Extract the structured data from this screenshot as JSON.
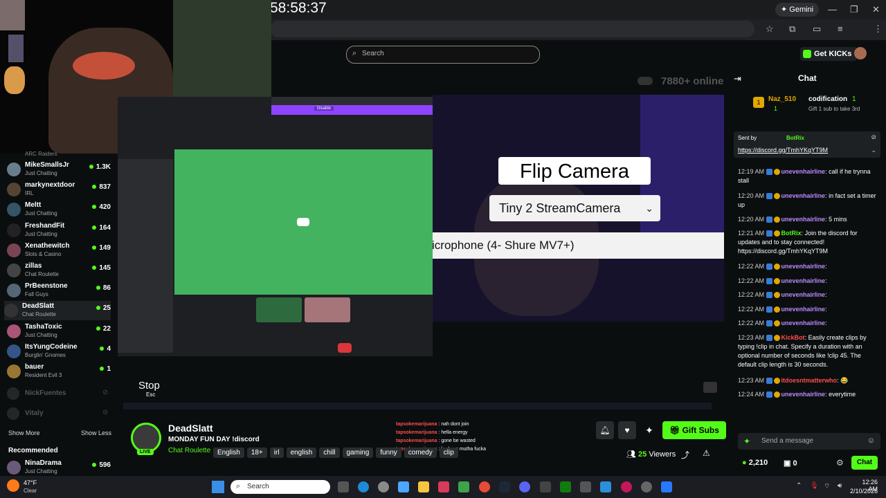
{
  "overlay_timer": "58:58:37",
  "browser": {
    "gemini_label": "Gemini",
    "controls": [
      "—",
      "❐",
      "✕"
    ]
  },
  "kick": {
    "search_placeholder": "Search",
    "get_kicks": "Get KICKs",
    "online_count": "7880+ online"
  },
  "sidebar": {
    "partial_top": "ARC Raiders",
    "items": [
      {
        "name": "MikeSmallsJr",
        "category": "Just Chatting",
        "viewers": "1.3K",
        "color": "#6a7d8a"
      },
      {
        "name": "markynextdoor",
        "category": "IRL",
        "viewers": "837",
        "color": "#554433"
      },
      {
        "name": "Meltt",
        "category": "Just Chatting",
        "viewers": "420",
        "color": "#335566"
      },
      {
        "name": "FreshandFit",
        "category": "Just Chatting",
        "viewers": "164",
        "color": "#222222"
      },
      {
        "name": "Xenathewitch",
        "category": "Slots & Casino",
        "viewers": "149",
        "color": "#7a4455"
      },
      {
        "name": "zillas",
        "category": "Chat Roulette",
        "viewers": "145",
        "color": "#444444"
      },
      {
        "name": "PrBeenstone",
        "category": "Fall Guys",
        "viewers": "86",
        "color": "#556677"
      },
      {
        "name": "DeadSlatt",
        "category": "Chat Roulette",
        "viewers": "25",
        "color": "#333333"
      },
      {
        "name": "TashaToxic",
        "category": "Just Chatting",
        "viewers": "22",
        "color": "#aa5577"
      },
      {
        "name": "ItsYungCodeine",
        "category": "Burglin' Gnomes",
        "viewers": "4",
        "color": "#335588"
      },
      {
        "name": "bauer",
        "category": "Resident Evil 3",
        "viewers": "1",
        "color": "#997733"
      }
    ],
    "offline": [
      "NickFuentes",
      "Vitaly"
    ],
    "show_more": "Show More",
    "show_less": "Show Less",
    "recommended_title": "Recommended",
    "recommended": {
      "name": "NinaDrama",
      "category": "Just Chatting",
      "viewers": "596"
    }
  },
  "video": {
    "flip_camera": "Flip Camera",
    "camera_select": "Tiny 2 StreamCamera",
    "mic_label": "icrophone (4- Shure MV7+)",
    "stop_label": "Stop",
    "stop_sub": "Esc",
    "discord_banner": "Disable"
  },
  "stream": {
    "streamer": "DeadSlatt",
    "title": "MONDAY FUN DAY !discord",
    "category": "Chat Roulette",
    "tags": [
      "English",
      "18+",
      "irl",
      "english",
      "chill",
      "gaming",
      "funny",
      "comedy",
      "clip"
    ],
    "live": "LIVE",
    "viewers_count": "25",
    "viewers_label": "Viewers",
    "gift_subs": "Gift Subs"
  },
  "overlay_chat": [
    {
      "user": "tapsokemarijuana",
      "msg": "nah dont join"
    },
    {
      "user": "tapsokemarijuana",
      "msg": "hella energy"
    },
    {
      "user": "tapsokemarijuana",
      "msg": "gone be wasted"
    },
    {
      "user": "tapsokemarijuana",
      "msg": "bad ass mutha fucka"
    }
  ],
  "chat": {
    "title": "Chat",
    "leader1_name": "Naz_510",
    "leader1_count": "1",
    "leader2_name": "codification",
    "leader2_count": "1",
    "leader_hint": "Gift 1 sub to take 3rd",
    "pinned_by": "Sent by",
    "pinned_user": "BotRix",
    "pinned_link": "https://discord.gg/TmhYKqYT9M",
    "messages": [
      {
        "time": "12:19 AM",
        "user": "unevenhairline",
        "text": "call if he trynna stall",
        "cls": "un"
      },
      {
        "time": "12:20 AM",
        "user": "unevenhairline",
        "text": "in fact set a timer up",
        "cls": "un"
      },
      {
        "time": "12:20 AM",
        "user": "unevenhairline",
        "text": "5 mins",
        "cls": "un"
      },
      {
        "time": "12:21 AM",
        "user": "BotRix",
        "text": "Join the discord for updates and to stay connected! https://discord.gg/TmhYKqYT9M",
        "cls": "gn"
      },
      {
        "time": "12:22 AM",
        "user": "unevenhairline",
        "text": "",
        "cls": "un"
      },
      {
        "time": "12:22 AM",
        "user": "unevenhairline",
        "text": "",
        "cls": "un"
      },
      {
        "time": "12:22 AM",
        "user": "unevenhairline",
        "text": "",
        "cls": "un"
      },
      {
        "time": "12:22 AM",
        "user": "unevenhairline",
        "text": "",
        "cls": "un"
      },
      {
        "time": "12:22 AM",
        "user": "unevenhairline",
        "text": "",
        "cls": "un"
      },
      {
        "time": "12:23 AM",
        "user": "KickBot",
        "text": "Easily create clips by typing !clip in chat. Specify a duration with an optional number of seconds like !clip 45. The default clip length is 30 seconds.",
        "cls": "rd"
      },
      {
        "time": "12:23 AM",
        "user": "itdoesntmatterwho",
        "text": "😂",
        "cls": "rd"
      },
      {
        "time": "12:24 AM",
        "user": "unevenhairline",
        "text": "everytime",
        "cls": "un"
      }
    ],
    "placeholder": "Send a message",
    "points": "2,210",
    "zero": "0",
    "chat_button": "Chat"
  },
  "taskbar": {
    "weather_temp": "47°F",
    "weather_desc": "Clear",
    "search": "Search",
    "time": "12:26 AM",
    "date": "2/10/2026"
  }
}
